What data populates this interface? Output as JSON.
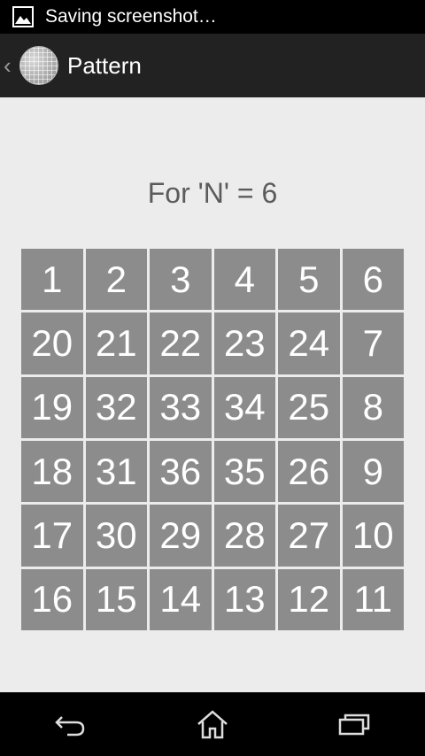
{
  "status_bar": {
    "text": "Saving screenshot…",
    "icon": "image-icon"
  },
  "action_bar": {
    "title": "Pattern",
    "back_icon": "chevron-left-icon",
    "app_icon": "app-grid-icon"
  },
  "heading": "For 'N' = 6",
  "grid": {
    "n": 6,
    "cells": [
      "1",
      "2",
      "3",
      "4",
      "5",
      "6",
      "20",
      "21",
      "22",
      "23",
      "24",
      "7",
      "19",
      "32",
      "33",
      "34",
      "25",
      "8",
      "18",
      "31",
      "36",
      "35",
      "26",
      "9",
      "17",
      "30",
      "29",
      "28",
      "27",
      "10",
      "16",
      "15",
      "14",
      "13",
      "12",
      "11"
    ]
  },
  "nav_bar": {
    "back": "back-icon",
    "home": "home-icon",
    "recents": "recents-icon"
  }
}
